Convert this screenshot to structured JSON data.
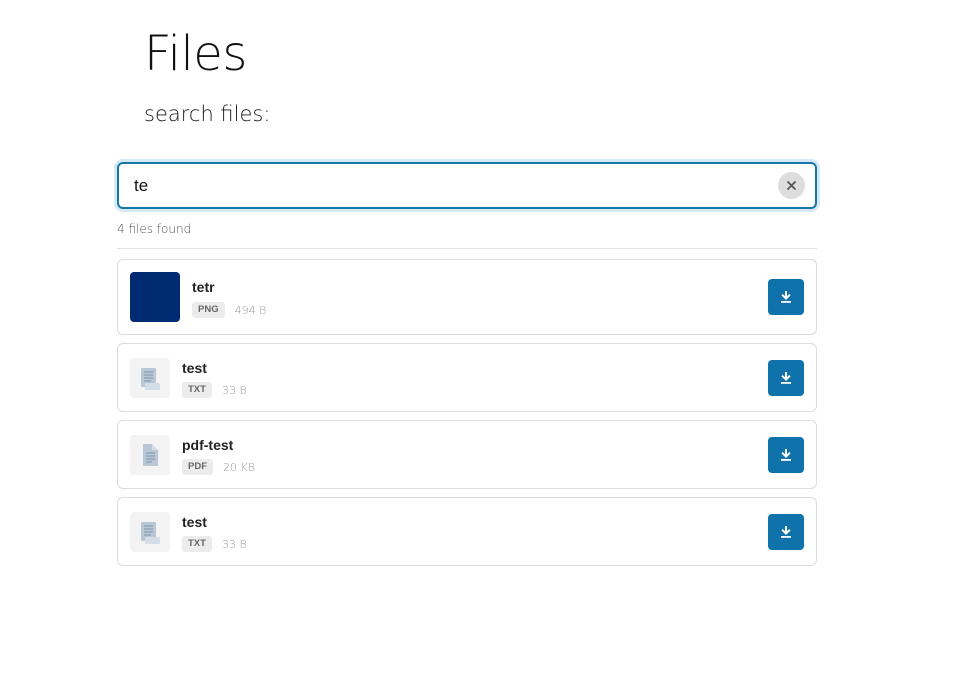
{
  "page": {
    "title": "Files",
    "search_label": "search files:"
  },
  "search": {
    "value": "te",
    "placeholder": ""
  },
  "results": {
    "count_text": "4 files found",
    "files": [
      {
        "name": "tetr",
        "type": "PNG",
        "size": "494 B",
        "thumbnail": "image-preview",
        "thumbnail_color": "#002a72"
      },
      {
        "name": "test",
        "type": "TXT",
        "size": "33 B",
        "thumbnail": "text-file-icon"
      },
      {
        "name": "pdf-test",
        "type": "PDF",
        "size": "20 KB",
        "thumbnail": "pdf-file-icon"
      },
      {
        "name": "test",
        "type": "TXT",
        "size": "33 B",
        "thumbnail": "text-file-icon"
      }
    ]
  },
  "colors": {
    "accent": "#0f72aa",
    "focus_border": "#1877a8",
    "badge_bg": "#ececec"
  },
  "icons": {
    "clear": "close-icon",
    "download": "download-icon"
  }
}
